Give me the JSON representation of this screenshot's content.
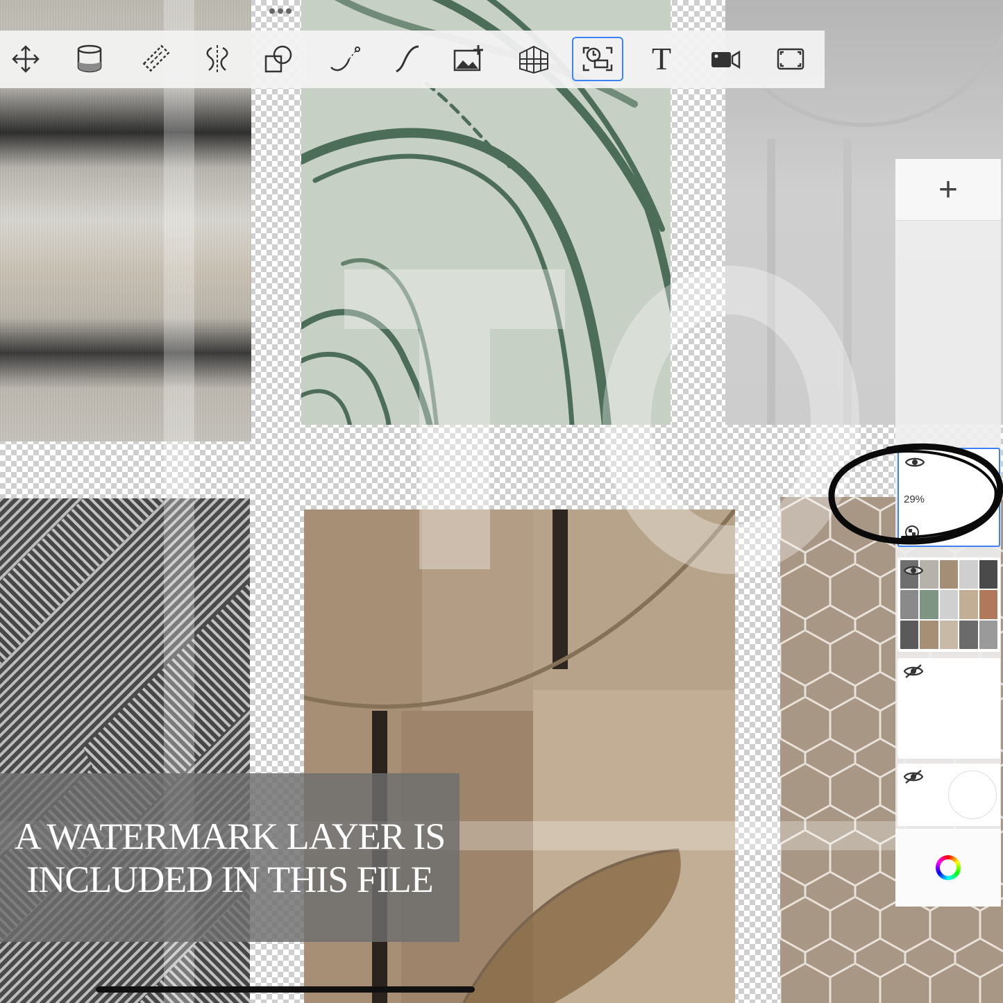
{
  "toolbar": {
    "tools": [
      {
        "name": "move-icon",
        "active": false
      },
      {
        "name": "fill-bucket-icon",
        "active": false
      },
      {
        "name": "ruler-icon",
        "active": false
      },
      {
        "name": "symmetry-icon",
        "active": false
      },
      {
        "name": "shapes-icon",
        "active": false
      },
      {
        "name": "curve-icon",
        "active": false
      },
      {
        "name": "stroke-icon",
        "active": false
      },
      {
        "name": "add-image-icon",
        "active": false
      },
      {
        "name": "perspective-grid-icon",
        "active": false
      },
      {
        "name": "time-lapse-icon",
        "active": true
      },
      {
        "name": "text-icon",
        "active": false,
        "glyph": "T"
      },
      {
        "name": "video-camera-icon",
        "active": false
      },
      {
        "name": "fullscreen-icon",
        "active": false
      }
    ],
    "accent_color": "#3b82f6"
  },
  "layers_panel": {
    "add_label": "+",
    "layers": [
      {
        "visible": true,
        "opacity": "29%",
        "selected": true
      },
      {
        "visible": true,
        "selected": false
      },
      {
        "visible": false,
        "selected": false
      },
      {
        "visible": false,
        "selected": false
      }
    ]
  },
  "banner": {
    "line1": "A WATERMARK LAYER IS",
    "line2": "INCLUDED IN THIS FILE"
  }
}
